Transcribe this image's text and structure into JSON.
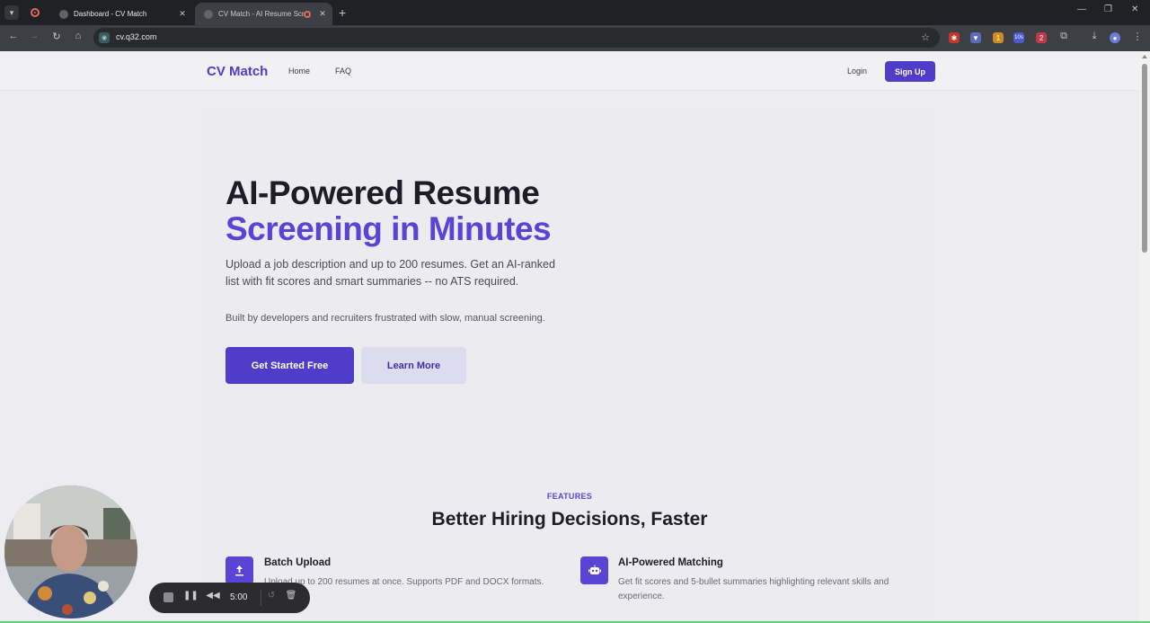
{
  "browser": {
    "tabs": [
      {
        "title": "Dashboard - CV Match",
        "active": false
      },
      {
        "title": "CV Match - AI Resume Scre",
        "active": true
      }
    ],
    "url": "cv.q32.com",
    "icons": [
      "tab-search-icon",
      "record-icon",
      "back-icon",
      "forward-icon",
      "reload-icon",
      "home-icon",
      "star-icon",
      "extensions-icon",
      "download-icon",
      "profile-icon",
      "menu-icon"
    ],
    "extension_badges": {
      "ext3": "1",
      "ext4": "10s",
      "ext5": "2"
    }
  },
  "site": {
    "logo": "CV Match",
    "nav": {
      "home": "Home",
      "faq": "FAQ",
      "login": "Login",
      "signup": "Sign Up"
    },
    "hero": {
      "title_line1": "AI-Powered Resume",
      "title_line2": "Screening in Minutes",
      "subtitle": "Upload a job description and up to 200 resumes. Get an AI-ranked list with fit scores and smart summaries -- no ATS required.",
      "built_by": "Built by developers and recruiters frustrated with slow, manual screening.",
      "cta_primary": "Get Started Free",
      "cta_secondary": "Learn More"
    },
    "features": {
      "tag": "FEATURES",
      "title": "Better Hiring Decisions, Faster",
      "items": [
        {
          "name": "Batch Upload",
          "desc": "Upload up to 200 resumes at once. Supports PDF and DOCX formats.",
          "icon": "upload-icon"
        },
        {
          "name": "AI-Powered Matching",
          "desc": "Get fit scores and 5-bullet summaries highlighting relevant skills and experience.",
          "icon": "robot-icon"
        }
      ]
    }
  },
  "recorder": {
    "time": "5:00"
  },
  "colors": {
    "brand": "#4f3cc9",
    "brand_light": "#5a44d6",
    "text_dark": "#1c1d27"
  }
}
